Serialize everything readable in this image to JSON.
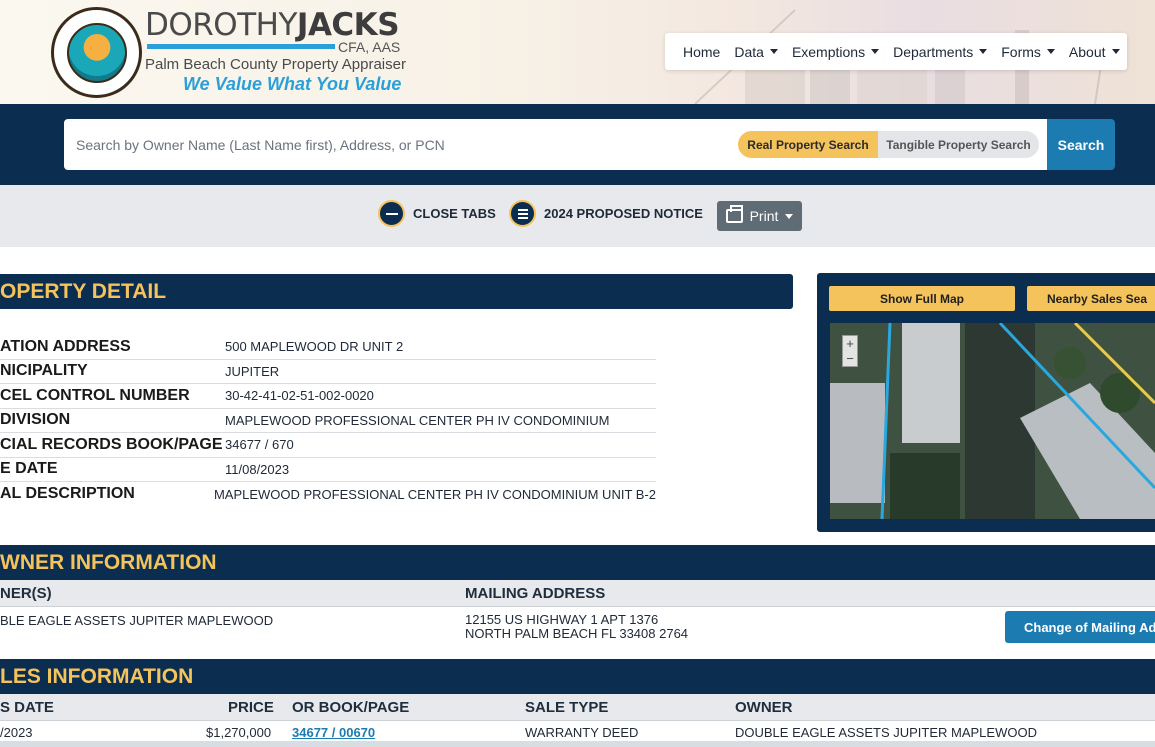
{
  "brand": {
    "name_light": "DOROTHY",
    "name_bold": "JACKS",
    "credentials": "CFA, AAS",
    "subtitle": "Palm Beach County Property Appraiser",
    "slogan": "We Value What You Value",
    "seal_text": "PALM BEACH COUNTY PROPERTY APPRAISER"
  },
  "nav": {
    "items": [
      {
        "label": "Home",
        "dropdown": false
      },
      {
        "label": "Data",
        "dropdown": true
      },
      {
        "label": "Exemptions",
        "dropdown": true
      },
      {
        "label": "Departments",
        "dropdown": true
      },
      {
        "label": "Forms",
        "dropdown": true
      },
      {
        "label": "About",
        "dropdown": true
      }
    ]
  },
  "search": {
    "placeholder": "Search by Owner Name (Last Name first), Address, or PCN",
    "toggle_real": "Real Property Search",
    "toggle_tangible": "Tangible Property Search",
    "button": "Search"
  },
  "toolbar": {
    "close_tabs": "CLOSE TABS",
    "proposed_notice": "2024 PROPOSED NOTICE",
    "print": "Print"
  },
  "property_detail": {
    "title": "OPERTY DETAIL",
    "rows": [
      {
        "label": "ATION ADDRESS",
        "value": "500 MAPLEWOOD DR UNIT 2"
      },
      {
        "label": "NICIPALITY",
        "value": "JUPITER"
      },
      {
        "label": "CEL CONTROL NUMBER",
        "value": "30-42-41-02-51-002-0020"
      },
      {
        "label": "DIVISION",
        "value": "MAPLEWOOD PROFESSIONAL CENTER PH IV CONDOMINIUM"
      },
      {
        "label": "CIAL RECORDS BOOK/PAGE",
        "value": "34677 / 670"
      },
      {
        "label": "E DATE",
        "value": "11/08/2023"
      },
      {
        "label": "AL DESCRIPTION",
        "value": "MAPLEWOOD PROFESSIONAL CENTER PH IV CONDOMINIUM UNIT B-2"
      }
    ]
  },
  "map": {
    "show_full_map": "Show Full Map",
    "nearby_sales": "Nearby Sales Sea",
    "zoom_in": "+",
    "zoom_out": "−"
  },
  "owner_information": {
    "title": "WNER INFORMATION",
    "col_owners": "NER(S)",
    "col_mailing": "MAILING ADDRESS",
    "owner": "BLE EAGLE ASSETS JUPITER MAPLEWOOD",
    "mailing_line1": "12155 US HIGHWAY 1 APT 1376",
    "mailing_line2": "NORTH PALM BEACH FL 33408 2764",
    "change_button": "Change of Mailing Ad"
  },
  "sales_information": {
    "title": "LES INFORMATION",
    "columns": {
      "date": "S DATE",
      "price": "PRICE",
      "book_page": "OR BOOK/PAGE",
      "sale_type": "SALE TYPE",
      "owner": "OWNER"
    },
    "row": {
      "date": "/2023",
      "price": "$1,270,000",
      "book_page": "34677 / 00670",
      "sale_type": "WARRANTY DEED",
      "owner": "DOUBLE EAGLE ASSETS JUPITER MAPLEWOOD"
    }
  },
  "colors": {
    "navy": "#0b2d4f",
    "gold": "#f5c35b",
    "blue": "#1c7bb0"
  }
}
